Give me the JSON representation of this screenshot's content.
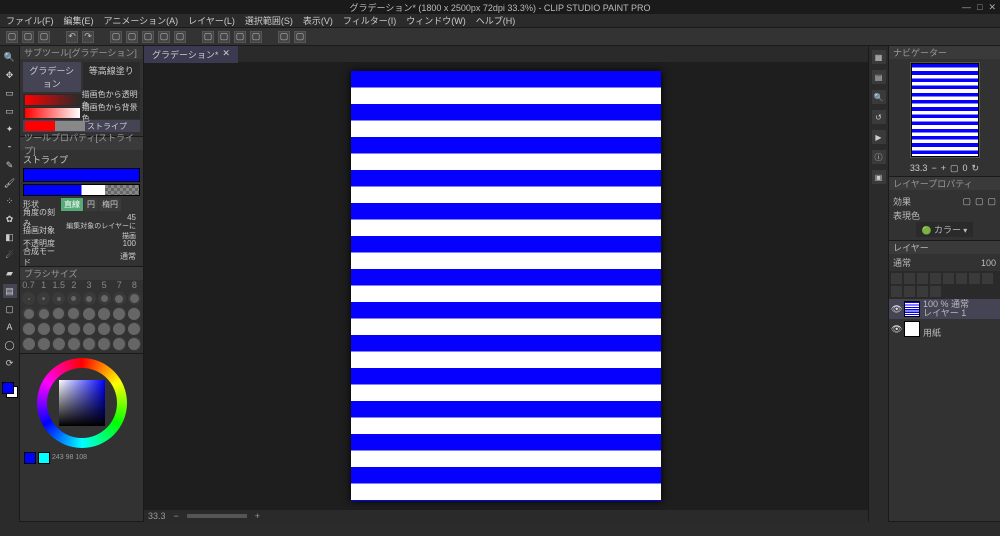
{
  "title": "グラデーション* (1800 x 2500px 72dpi 33.3%) - CLIP STUDIO PAINT PRO",
  "menu": [
    "ファイル(F)",
    "編集(E)",
    "アニメーション(A)",
    "レイヤー(L)",
    "選択範囲(S)",
    "表示(V)",
    "フィルター(I)",
    "ウィンドウ(W)",
    "ヘルプ(H)"
  ],
  "doc_tab": "グラデーション*",
  "subtool_panel": {
    "title": "サブツール[グラデーション]",
    "tabs": [
      "グラデーション",
      "等高線塗り"
    ],
    "items": [
      {
        "label": "描画色から透明色"
      },
      {
        "label": "描画色から背景色"
      },
      {
        "label": "ストライプ",
        "selected": true
      }
    ]
  },
  "toolprop": {
    "title": "ツールプロパティ[ストライプ]",
    "name": "ストライプ",
    "shape_label": "形状",
    "shapes": [
      "直線",
      "円",
      "楕円"
    ],
    "shape_active": "直線",
    "angle_label": "角度の刻み",
    "angle_val": "45",
    "target_label": "描画対象",
    "target_val": "編集対象のレイヤーに描画",
    "opacity_label": "不透明度",
    "opacity_val": "100",
    "blend_label": "合成モード",
    "blend_val": "通常"
  },
  "brushsize": {
    "title": "ブラシサイズ",
    "sizes": [
      "0.7",
      "1",
      "1.5",
      "2",
      "3",
      "5",
      "7",
      "8"
    ]
  },
  "color": {
    "rgb": "243 98 108"
  },
  "navigator": {
    "title": "ナビゲーター",
    "zoom": "33.3",
    "angle": "0"
  },
  "layerprop": {
    "title": "レイヤープロパティ",
    "effect": "効果",
    "expr": "表現色",
    "expr_val": "カラー"
  },
  "layers": {
    "title": "レイヤー",
    "blend": "通常",
    "opacity": "100",
    "items": [
      {
        "name": "レイヤー 1",
        "info": "100 % 通常",
        "selected": true
      },
      {
        "name": "用紙",
        "info": ""
      }
    ]
  },
  "hscroll": {
    "zoom": "33.3"
  }
}
